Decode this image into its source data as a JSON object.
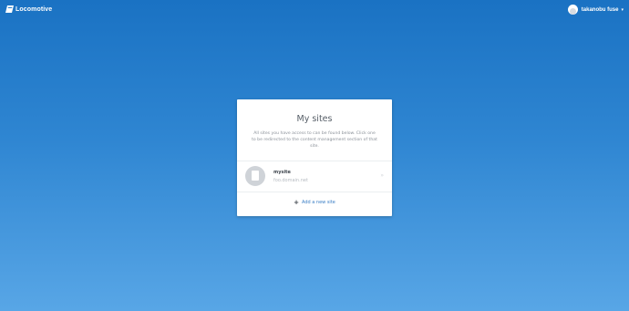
{
  "header": {
    "brand": "Locomotive",
    "user_name": "takanobu fuse",
    "user_caret": "▾"
  },
  "card": {
    "title": "My sites",
    "description": "All sites you have access to can be found below. Click one to be redirected to the content management section of that site.",
    "sites": [
      {
        "name": "mysite",
        "domain": "foo.domain.net",
        "arrow": "»"
      }
    ],
    "add_site": {
      "icon": "+",
      "label": "Add a new site"
    }
  },
  "colors": {
    "background_top": "#1a72c3",
    "background_bottom": "#58a6e6",
    "link": "#3a7ec5"
  }
}
